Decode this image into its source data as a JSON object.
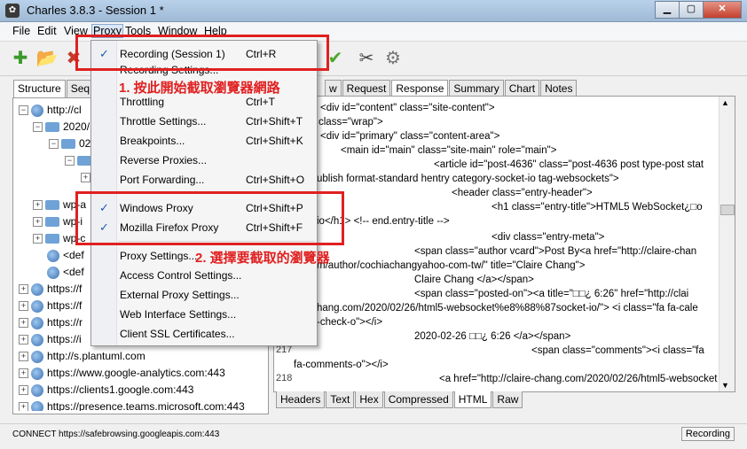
{
  "window": {
    "title": "Charles 3.8.3 - Session 1 *",
    "app_icon": "charles-icon"
  },
  "menubar": {
    "items": [
      "File",
      "Edit",
      "View",
      "Proxy",
      "Tools",
      "Window",
      "Help"
    ]
  },
  "left_tabs": [
    "Structure",
    "Seq"
  ],
  "tree": [
    "http://cl",
    "2020/",
    "02",
    "wp-a",
    "wp-i",
    "wp-c",
    "<def",
    "<def",
    "https://f",
    "https://f",
    "https://r",
    "https://i",
    "http://s.plantuml.com",
    "https://www.google-analytics.com:443",
    "https://clients1.google.com:443",
    "https://presence.teams.microsoft.com:443"
  ],
  "right_tabs": [
    "w",
    "Request",
    "Response",
    "Summary",
    "Chart",
    "Notes"
  ],
  "code_lines": [
    "<div id=\"content\" class=\"site-content\">",
    "class=\"wrap\">",
    "<div id=\"primary\" class=\"content-area\">",
    "<main id=\"main\" class=\"site-main\" role=\"main\">",
    "<article id=\"post-4636\" class=\"post-4636 post type-post stat",
    "ublish format-standard hentry category-socket-io tag-websockets\">",
    "<header class=\"entry-header\">",
    "<h1 class=\"entry-title\">HTML5 WebSocket¿□o",
    "io</h1> <!-- end.entry-title -->",
    "<div class=\"entry-meta\">",
    "<span class=\"author vcard\">Post By<a href=\"http://claire-chan",
    "m/author/cochiachangyahoo-com-tw/\" title=\"Claire Chang\">",
    "Claire Chang </a></span>",
    "<span class=\"posted-on\"><a title=\"□□¿ 6:26\" href=\"http://clai",
    "hang.com/2020/02/26/html5-websocket%e8%88%87socket-io/\"> <i class=\"fa fa-cale",
    "-check-o\"></i>",
    "2020-02-26 □□¿ 6:26 </a></span>",
    "<span class=\"comments\"><i class=\"fa",
    "fa-comments-o\"></i>",
    "<a href=\"http://claire-chang.com/2020/02/26/html5-websocket"
  ],
  "line_numbers": [
    "217",
    "218"
  ],
  "bottom_tabs": [
    "Headers",
    "Text",
    "Hex",
    "Compressed",
    "HTML",
    "Raw"
  ],
  "status": {
    "message": "CONNECT https://safebrowsing.googleapis.com:443",
    "recording": "Recording"
  },
  "proxy_menu": {
    "items": [
      {
        "label": "Recording (Session 1)",
        "shortcut": "Ctrl+R",
        "checked": true
      },
      {
        "label": "Recording Settings...",
        "shortcut": ""
      },
      {
        "label": "Throttling",
        "shortcut": "Ctrl+T"
      },
      {
        "label": "Throttle Settings...",
        "shortcut": "Ctrl+Shift+T"
      },
      {
        "label": "Breakpoints...",
        "shortcut": "Ctrl+Shift+K"
      },
      {
        "label": "Reverse Proxies...",
        "shortcut": ""
      },
      {
        "label": "Port Forwarding...",
        "shortcut": "Ctrl+Shift+O"
      },
      {
        "label": "Windows Proxy",
        "shortcut": "Ctrl+Shift+P",
        "checked": true
      },
      {
        "label": "Mozilla Firefox Proxy",
        "shortcut": "Ctrl+Shift+F",
        "checked": true
      },
      {
        "label": "Proxy Settings...",
        "shortcut": ""
      },
      {
        "label": "Access Control Settings...",
        "shortcut": ""
      },
      {
        "label": "External Proxy Settings...",
        "shortcut": ""
      },
      {
        "label": "Web Interface Settings...",
        "shortcut": ""
      },
      {
        "label": "Client SSL Certificates...",
        "shortcut": ""
      }
    ]
  },
  "annotations": {
    "step1": "1. 按此開始截取瀏覽器網路",
    "step2": "2. 選擇要截取的瀏覽器",
    "color": "#e02020"
  },
  "colors": {
    "accent": "#e02020",
    "selection": "#1e5bb3"
  }
}
